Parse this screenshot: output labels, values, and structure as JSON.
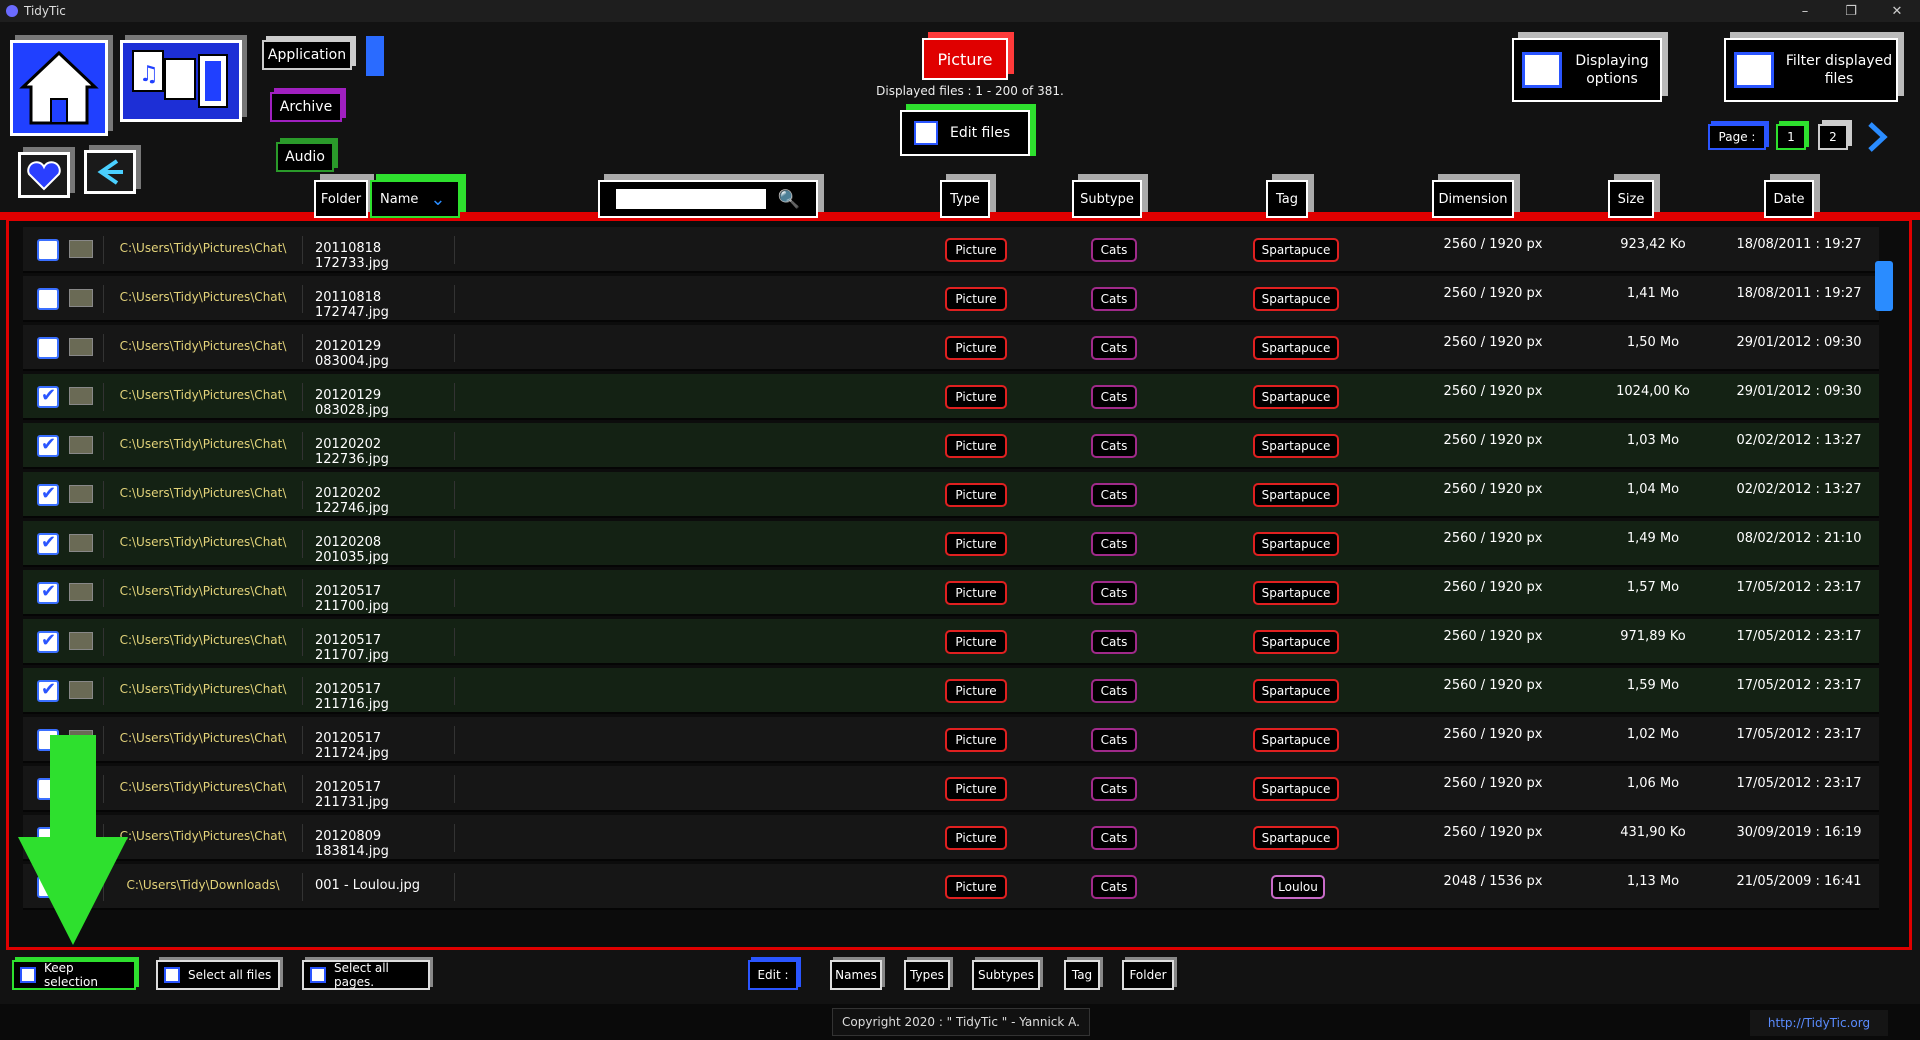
{
  "window": {
    "title": "TidyTic",
    "controls": [
      "–",
      "❐",
      "✕"
    ]
  },
  "top": {
    "categories": [
      "Application",
      "Archive",
      "Audio"
    ],
    "active_type": "Picture",
    "displayed_text": "Displayed files : 1 - 200 of 381.",
    "edit_files": "Edit files",
    "displaying_options": "Displaying options",
    "filter_displayed": "Filter displayed files",
    "page_label": "Page :",
    "pages": [
      "1",
      "2"
    ]
  },
  "columns": {
    "folder": "Folder",
    "name": "Name",
    "type": "Type",
    "subtype": "Subtype",
    "tag": "Tag",
    "dimension": "Dimension",
    "size": "Size",
    "date": "Date",
    "search_placeholder": ""
  },
  "rows": [
    {
      "checked": false,
      "folder": "C:\\Users\\Tidy\\Pictures\\Chat\\",
      "name": "20110818 172733.jpg",
      "type": "Picture",
      "subtype": "Cats",
      "tag": "Spartapuce",
      "dimension": "2560 / 1920 px",
      "size": "923,42 Ko",
      "date": "18/08/2011 : 19:27"
    },
    {
      "checked": false,
      "folder": "C:\\Users\\Tidy\\Pictures\\Chat\\",
      "name": "20110818 172747.jpg",
      "type": "Picture",
      "subtype": "Cats",
      "tag": "Spartapuce",
      "dimension": "2560 / 1920 px",
      "size": "1,41 Mo",
      "date": "18/08/2011 : 19:27"
    },
    {
      "checked": false,
      "folder": "C:\\Users\\Tidy\\Pictures\\Chat\\",
      "name": "20120129 083004.jpg",
      "type": "Picture",
      "subtype": "Cats",
      "tag": "Spartapuce",
      "dimension": "2560 / 1920 px",
      "size": "1,50 Mo",
      "date": "29/01/2012 : 09:30"
    },
    {
      "checked": true,
      "folder": "C:\\Users\\Tidy\\Pictures\\Chat\\",
      "name": "20120129 083028.jpg",
      "type": "Picture",
      "subtype": "Cats",
      "tag": "Spartapuce",
      "dimension": "2560 / 1920 px",
      "size": "1024,00 Ko",
      "date": "29/01/2012 : 09:30"
    },
    {
      "checked": true,
      "folder": "C:\\Users\\Tidy\\Pictures\\Chat\\",
      "name": "20120202 122736.jpg",
      "type": "Picture",
      "subtype": "Cats",
      "tag": "Spartapuce",
      "dimension": "2560 / 1920 px",
      "size": "1,03 Mo",
      "date": "02/02/2012 : 13:27"
    },
    {
      "checked": true,
      "folder": "C:\\Users\\Tidy\\Pictures\\Chat\\",
      "name": "20120202 122746.jpg",
      "type": "Picture",
      "subtype": "Cats",
      "tag": "Spartapuce",
      "dimension": "2560 / 1920 px",
      "size": "1,04 Mo",
      "date": "02/02/2012 : 13:27"
    },
    {
      "checked": true,
      "folder": "C:\\Users\\Tidy\\Pictures\\Chat\\",
      "name": "20120208 201035.jpg",
      "type": "Picture",
      "subtype": "Cats",
      "tag": "Spartapuce",
      "dimension": "2560 / 1920 px",
      "size": "1,49 Mo",
      "date": "08/02/2012 : 21:10"
    },
    {
      "checked": true,
      "folder": "C:\\Users\\Tidy\\Pictures\\Chat\\",
      "name": "20120517 211700.jpg",
      "type": "Picture",
      "subtype": "Cats",
      "tag": "Spartapuce",
      "dimension": "2560 / 1920 px",
      "size": "1,57 Mo",
      "date": "17/05/2012 : 23:17"
    },
    {
      "checked": true,
      "folder": "C:\\Users\\Tidy\\Pictures\\Chat\\",
      "name": "20120517 211707.jpg",
      "type": "Picture",
      "subtype": "Cats",
      "tag": "Spartapuce",
      "dimension": "2560 / 1920 px",
      "size": "971,89 Ko",
      "date": "17/05/2012 : 23:17"
    },
    {
      "checked": true,
      "folder": "C:\\Users\\Tidy\\Pictures\\Chat\\",
      "name": "20120517 211716.jpg",
      "type": "Picture",
      "subtype": "Cats",
      "tag": "Spartapuce",
      "dimension": "2560 / 1920 px",
      "size": "1,59 Mo",
      "date": "17/05/2012 : 23:17"
    },
    {
      "checked": false,
      "folder": "C:\\Users\\Tidy\\Pictures\\Chat\\",
      "name": "20120517 211724.jpg",
      "type": "Picture",
      "subtype": "Cats",
      "tag": "Spartapuce",
      "dimension": "2560 / 1920 px",
      "size": "1,02 Mo",
      "date": "17/05/2012 : 23:17"
    },
    {
      "checked": false,
      "folder": "C:\\Users\\Tidy\\Pictures\\Chat\\",
      "name": "20120517 211731.jpg",
      "type": "Picture",
      "subtype": "Cats",
      "tag": "Spartapuce",
      "dimension": "2560 / 1920 px",
      "size": "1,06 Mo",
      "date": "17/05/2012 : 23:17"
    },
    {
      "checked": false,
      "folder": "C:\\Users\\Tidy\\Pictures\\Chat\\",
      "name": "20120809 183814.jpg",
      "type": "Picture",
      "subtype": "Cats",
      "tag": "Spartapuce",
      "dimension": "2560 / 1920 px",
      "size": "431,90 Ko",
      "date": "30/09/2019 : 16:19"
    },
    {
      "checked": false,
      "folder": "C:\\Users\\Tidy\\Downloads\\",
      "name": "001 - Loulou.jpg",
      "type": "Picture",
      "subtype": "Cats",
      "tag": "Loulou",
      "dimension": "2048 / 1536 px",
      "size": "1,13 Mo",
      "date": "21/05/2009 : 16:41"
    }
  ],
  "bottom": {
    "keep_selection": "Keep selection",
    "select_all_files": "Select all files",
    "select_all_pages": "Select all pages.",
    "edit_label": "Edit :",
    "edit_buttons": [
      "Names",
      "Types",
      "Subtypes",
      "Tag",
      "Folder"
    ],
    "copyright": "Copyright 2020 : \" TidyTic \" - Yannick A.",
    "link": "http://TidyTic.org"
  },
  "colors": {
    "accent_red": "#e00000",
    "green": "#2ee02e",
    "blue": "#2a8cff"
  }
}
